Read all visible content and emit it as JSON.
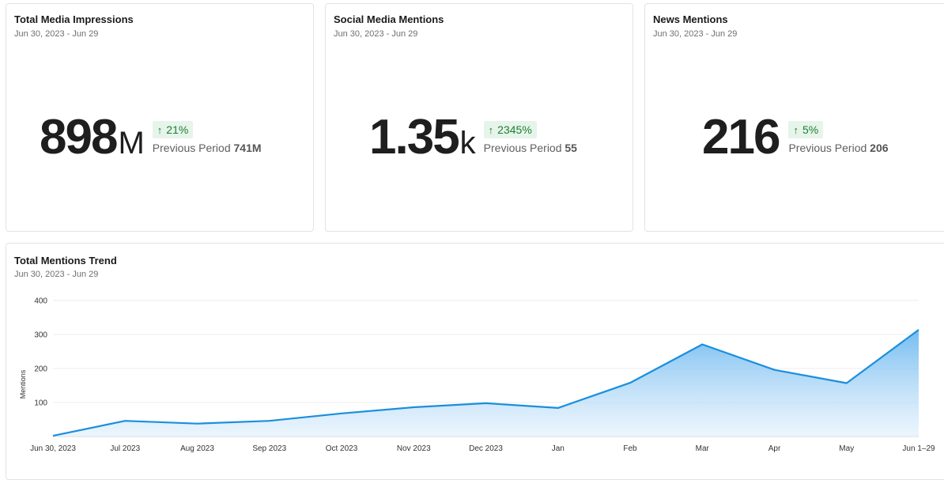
{
  "cards": [
    {
      "title": "Total Media Impressions",
      "date_range": "Jun 30, 2023 - Jun 29",
      "value": "898",
      "unit": "M",
      "change": "21%",
      "previous_label": "Previous Period",
      "previous_value": "741M"
    },
    {
      "title": "Social Media Mentions",
      "date_range": "Jun 30, 2023 - Jun 29",
      "value": "1.35",
      "unit": "k",
      "change": "2345%",
      "previous_label": "Previous Period",
      "previous_value": "55"
    },
    {
      "title": "News Mentions",
      "date_range": "Jun 30, 2023 - Jun 29",
      "value": "216",
      "unit": "",
      "change": "5%",
      "previous_label": "Previous Period",
      "previous_value": "206"
    }
  ],
  "colors": {
    "accent": "#1a8fdd",
    "positive_bg": "#e6f4ea",
    "positive_text": "#1e7e34"
  },
  "icons": {
    "change": "arrow-up-icon"
  },
  "trend": {
    "title": "Total Mentions Trend",
    "date_range": "Jun 30, 2023 - Jun 29"
  },
  "chart_data": {
    "type": "area",
    "categories": [
      "Jun 30, 2023",
      "Jul 2023",
      "Aug 2023",
      "Sep 2023",
      "Oct 2023",
      "Nov 2023",
      "Dec 2023",
      "Jan",
      "Feb",
      "Mar",
      "Apr",
      "May",
      "Jun 1–29"
    ],
    "series": [
      {
        "values": [
          2,
          46,
          38,
          46,
          68,
          86,
          98,
          84,
          158,
          271,
          196,
          157,
          314
        ]
      }
    ],
    "ylabel": "Mentions",
    "yticks": [
      100,
      200,
      300,
      400
    ],
    "ylim": [
      0,
      400
    ],
    "grid": true
  }
}
